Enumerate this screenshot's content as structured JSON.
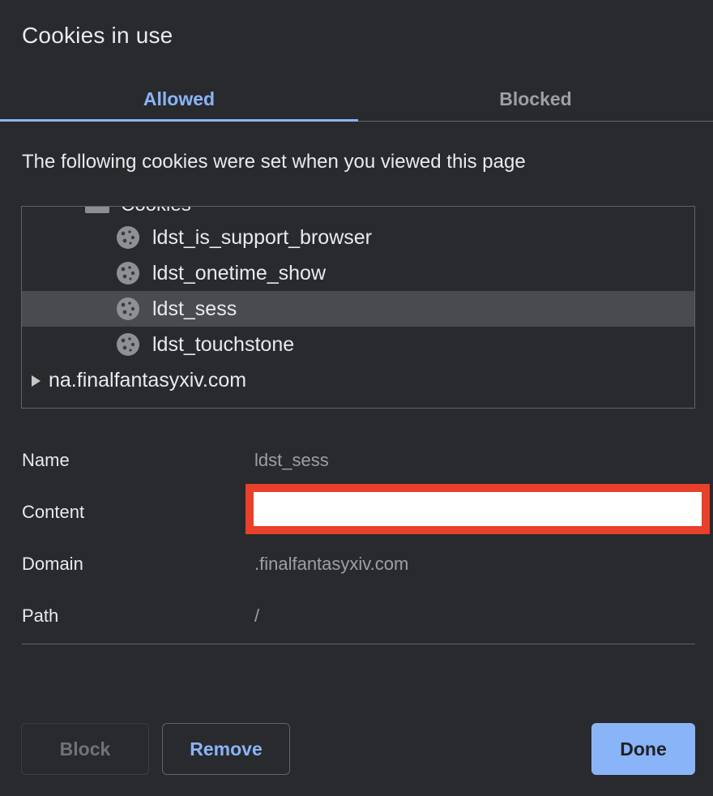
{
  "dialog": {
    "title": "Cookies in use",
    "tabs": [
      {
        "label": "Allowed",
        "active": true
      },
      {
        "label": "Blocked",
        "active": false
      }
    ],
    "description": "The following cookies were set when you viewed this page"
  },
  "tree": {
    "partial_folder_label": "Cookies",
    "cookies": [
      {
        "label": "ldst_is_support_browser",
        "icon": "cookie-icon",
        "selected": false
      },
      {
        "label": "ldst_onetime_show",
        "icon": "cookie-icon",
        "selected": false
      },
      {
        "label": "ldst_sess",
        "icon": "cookie-icon",
        "selected": true
      },
      {
        "label": "ldst_touchstone",
        "icon": "cookie-icon",
        "selected": false
      }
    ],
    "domain": {
      "label": "na.finalfantasyxiv.com",
      "icon": "expand-arrow-icon"
    }
  },
  "details": {
    "name_label": "Name",
    "name_value": "ldst_sess",
    "content_label": "Content",
    "content_value": "",
    "domain_label": "Domain",
    "domain_value": ".finalfantasyxiv.com",
    "path_label": "Path",
    "path_value": "/"
  },
  "buttons": {
    "block": "Block",
    "remove": "Remove",
    "done": "Done"
  },
  "colors": {
    "background": "#292a2d",
    "accent": "#8ab4f8",
    "selected_row": "#4a4b4f",
    "redaction_border": "#e8402b"
  }
}
